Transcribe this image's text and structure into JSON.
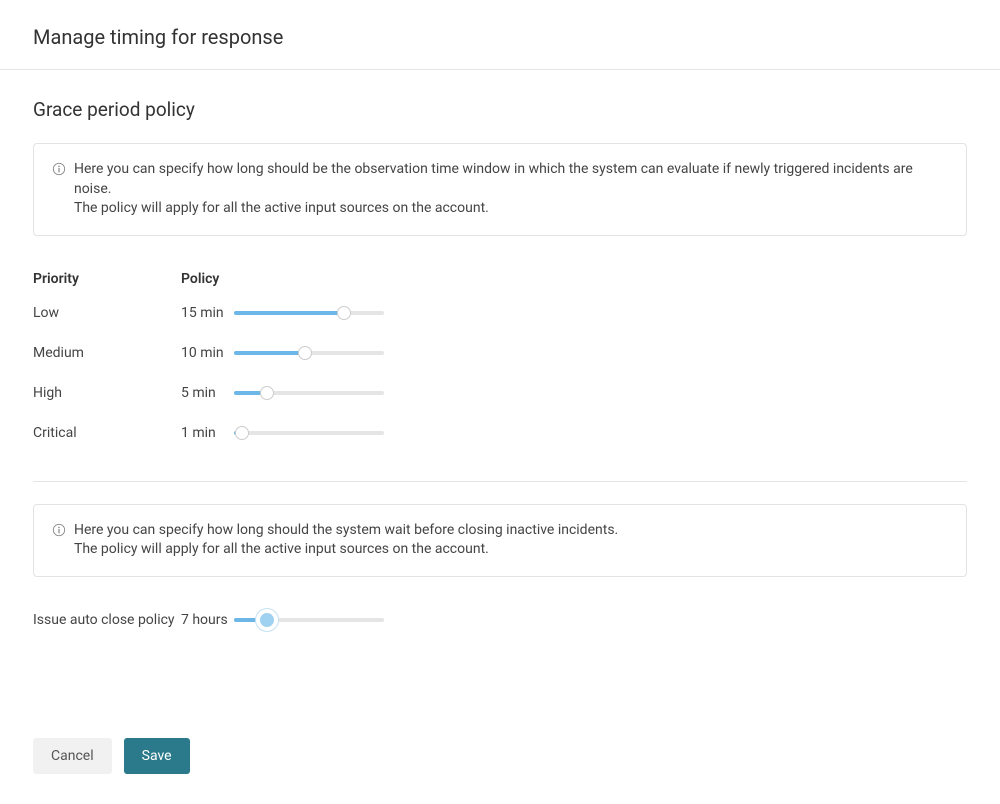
{
  "page_title": "Manage timing for response",
  "section_title": "Grace period policy",
  "info_box_1": {
    "line1": "Here you can specify how long should be the observation time window in which the system can evaluate if newly triggered incidents are noise.",
    "line2": "The policy will apply for all the active input sources on the account."
  },
  "table_headers": {
    "priority": "Priority",
    "policy": "Policy"
  },
  "priority_rows": [
    {
      "priority": "Low",
      "value": "15 min",
      "fill_pct": 73,
      "thumb_pct": 73
    },
    {
      "priority": "Medium",
      "value": "10 min",
      "fill_pct": 47,
      "thumb_pct": 47
    },
    {
      "priority": "High",
      "value": "5 min",
      "fill_pct": 22,
      "thumb_pct": 22
    },
    {
      "priority": "Critical",
      "value": "1 min",
      "fill_pct": 3,
      "thumb_pct": 5
    }
  ],
  "info_box_2": {
    "line1": "Here you can specify how long should the system wait before closing inactive incidents.",
    "line2": "The policy will apply for all the active input sources on the account."
  },
  "auto_close": {
    "label": "Issue auto close policy",
    "value": "7 hours",
    "fill_pct": 22,
    "thumb_pct": 22
  },
  "buttons": {
    "cancel": "Cancel",
    "save": "Save"
  }
}
